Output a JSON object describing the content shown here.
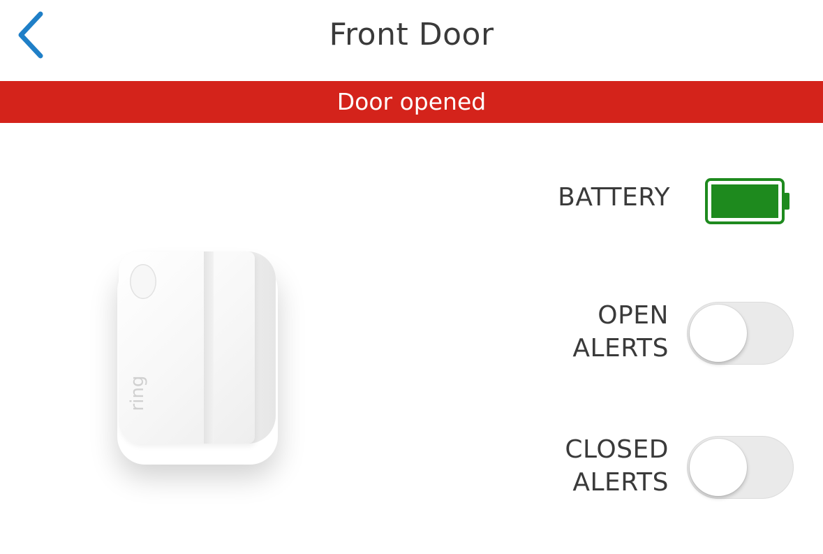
{
  "header": {
    "title": "Front Door",
    "back_icon": "chevron-left-icon"
  },
  "banner": {
    "text": "Door opened",
    "color": "#d4231b"
  },
  "device": {
    "logo_text": "ring"
  },
  "battery": {
    "label": "BATTERY",
    "level_fraction": 1.0,
    "color": "#1e8a1e",
    "icon": "battery-full-icon"
  },
  "alerts": {
    "open": {
      "line1": "OPEN",
      "line2": "ALERTS",
      "enabled": false
    },
    "closed": {
      "line1": "CLOSED",
      "line2": "ALERTS",
      "enabled": false
    }
  },
  "colors": {
    "accent": "#1f7fc7",
    "text": "#3a3a3a",
    "toggle_off": "#eaeaea"
  }
}
